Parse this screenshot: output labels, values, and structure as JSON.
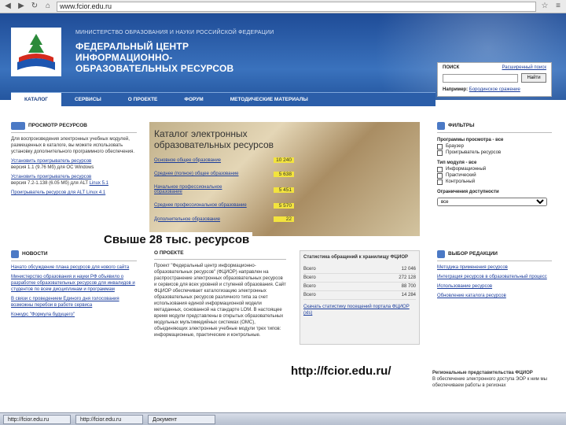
{
  "browser": {
    "url": "www.fcior.edu.ru"
  },
  "header": {
    "ministry": "МИНИСТЕРСТВО ОБРАЗОВАНИЯ И НАУКИ РОССИЙСКОЙ ФЕДЕРАЦИИ",
    "center_title": "ФЕДЕРАЛЬНЫЙ ЦЕНТР ИНФОРМАЦИОННО-ОБРАЗОВАТЕЛЬНЫХ РЕСУРСОВ"
  },
  "search": {
    "label": "ПОИСК",
    "advanced": "Расширенный поиск",
    "button": "Найти",
    "example_prefix": "Например:",
    "example": "Бородинское сражение"
  },
  "nav": [
    {
      "label": "КАТАЛОГ"
    },
    {
      "label": "СЕРВИСЫ"
    },
    {
      "label": "О ПРОЕКТЕ"
    },
    {
      "label": "ФОРУМ"
    },
    {
      "label": "МЕТОДИЧЕСКИЕ МАТЕРИАЛЫ"
    }
  ],
  "left": {
    "title": "ПРОСМОТР РЕСУРСОВ",
    "intro": "Для воспроизведения электронных учебных модулей, размещенных в каталоге, вы можете использовать установку дополнительного программного обеспечения.",
    "links": [
      "Установить проигрыватель ресурсов",
      "Установить проигрыватель ресурсов",
      "Linux 5.1",
      "Проигрыватель ресурсов для ALT Linux 4.1"
    ],
    "notes": [
      "версия 1.1 (9.76 Мб) для ОС Windows",
      "версия 7.2-1.138 (6.05 Мб) для ALT"
    ]
  },
  "catalog": {
    "title": "Каталог электронных образовательных ресурсов",
    "rows": [
      {
        "name": "Основное общее образование",
        "value": "10 240"
      },
      {
        "name": "Среднее (полное) общее образование",
        "value": "5 638"
      },
      {
        "name": "Начальное профессиональное образование",
        "value": "5 451"
      },
      {
        "name": "Среднее профессиональное образование",
        "value": "5 570"
      },
      {
        "name": "Дополнительное образование",
        "value": "22"
      }
    ]
  },
  "callouts": {
    "resources": "Свыше 28 тыс. ресурсов",
    "url": "http://fcior.edu.ru/"
  },
  "filters": {
    "title": "ФИЛЬТРЫ",
    "viewer": "Программы просмотра - все",
    "viewer_opts": [
      "Браузер",
      "Проигрыватель ресурсов"
    ],
    "module": "Тип модуля - все",
    "module_opts": [
      "Информационный",
      "Практический",
      "Контрольный"
    ],
    "access": "Ограничения доступности",
    "access_value": "все"
  },
  "news": {
    "title": "НОВОСТИ",
    "items": [
      "Начато обсуждение плана ресурсов для нового сайта",
      "Министерство образования и науки РФ объявило о разработке образовательных ресурсов для инвалидов и студентов по всем дисциплинам и программам",
      "В связи с проведением Единого дня голосования возможны перебои в работе сервиса",
      "Конкурс \"Формула будущего\""
    ]
  },
  "about": {
    "title": "О ПРОЕКТЕ",
    "text": "Проект \"Федеральный центр информационно-образовательных ресурсов\" (ФЦИОР) направлен на распространение электронных образовательных ресурсов и сервисов для всех уровней и ступеней образования. Сайт ФЦИОР обеспечивает каталогизацию электронных образовательных ресурсов различного типа за счет использования единой информационной модели метаданных, основанной на стандарте LOM. В настоящее время модули представлены в открытых образовательных модульных мультимедийных системах (ОМС), объединяющих электронные учебные модули трех типов: информационные, практические и контрольные."
  },
  "stats": {
    "title": "Статистика обращений к хранилищу ФЦИОР",
    "header": "Всего",
    "rows": [
      {
        "label": "Всего",
        "value": "12 046"
      },
      {
        "label": "Всего",
        "value": "272 128"
      },
      {
        "label": "Всего",
        "value": "88 700"
      },
      {
        "label": "Всего",
        "value": "14 284"
      }
    ],
    "link": "Скачать статистику посещений портала ФЦИОР (xls)"
  },
  "editor": {
    "title": "ВЫБОР РЕДАКЦИИ",
    "items": [
      "Методика применения ресурсов",
      "Интеграция ресурсов в образовательный процесс",
      "Использование ресурсов",
      "Обновление каталога ресурсов"
    ]
  },
  "regional": {
    "title": "Региональные представительства ФЦИОР",
    "text": "В обеспечение электронного доступа ЭОР к ним мы обеспечиваем работы в регионах"
  },
  "taskbar": [
    {
      "label": "http://fcior.edu.ru"
    },
    {
      "label": "http://fcior.edu.ru"
    },
    {
      "label": "Документ"
    }
  ]
}
